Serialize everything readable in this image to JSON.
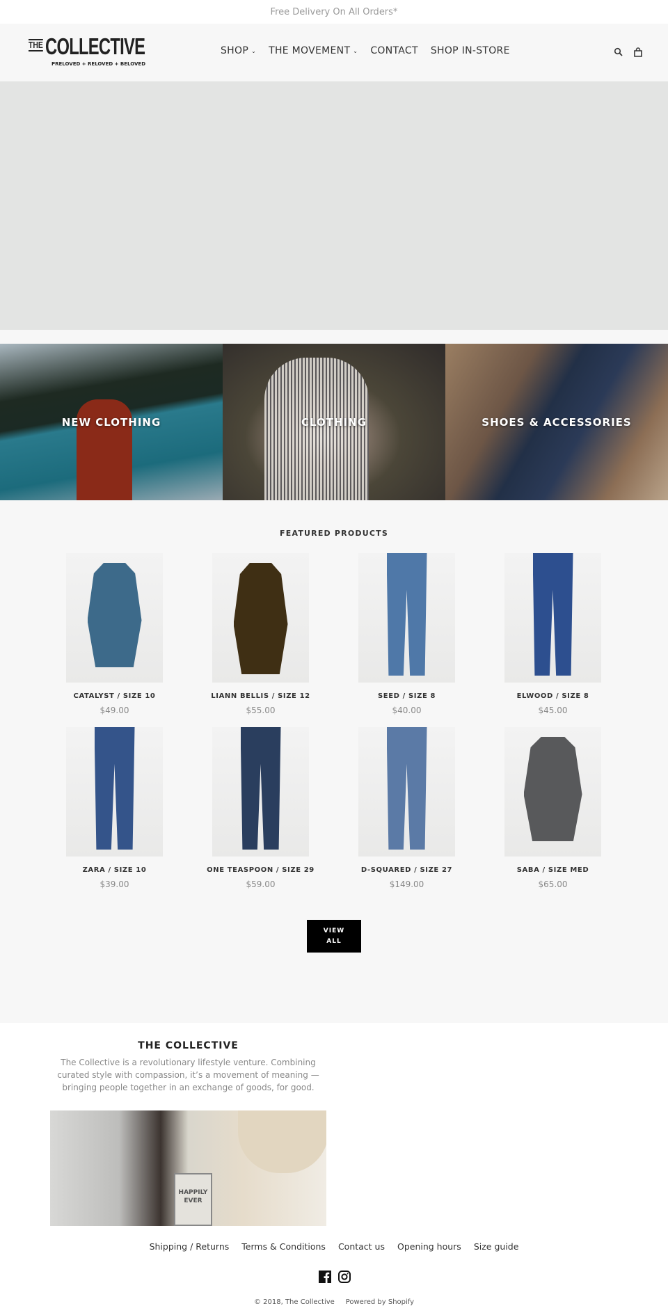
{
  "announcement": "Free Delivery On All Orders*",
  "logo": {
    "the": "THE",
    "name": "COLLECTIVE",
    "tagline": "PRELOVED + RELOVED + BELOVED"
  },
  "nav": [
    {
      "label": "SHOP",
      "dropdown": true
    },
    {
      "label": "THE MOVEMENT",
      "dropdown": true
    },
    {
      "label": "CONTACT",
      "dropdown": false
    },
    {
      "label": "SHOP IN-STORE",
      "dropdown": false
    }
  ],
  "header_icons": [
    "search-icon",
    "cart-icon"
  ],
  "collections": [
    {
      "label": "NEW CLOTHING"
    },
    {
      "label": "CLOTHING"
    },
    {
      "label": "SHOES & ACCESSORIES"
    }
  ],
  "featured": {
    "title": "FEATURED PRODUCTS",
    "view_all": "VIEW ALL",
    "products": [
      {
        "title": "CATALYST / SIZE 10",
        "price": "$49.00",
        "color": "#3d6a8a"
      },
      {
        "title": "LIANN BELLIS / SIZE 12",
        "price": "$55.00",
        "color": "#3f2f14"
      },
      {
        "title": "SEED / SIZE 8",
        "price": "$40.00",
        "color": "#4f78a8"
      },
      {
        "title": "ELWOOD / SIZE 8",
        "price": "$45.00",
        "color": "#2d4f8f"
      },
      {
        "title": "ZARA / SIZE 10",
        "price": "$39.00",
        "color": "#34548a"
      },
      {
        "title": "ONE TEASPOON / SIZE 29",
        "price": "$59.00",
        "color": "#2a3e5e"
      },
      {
        "title": "D-SQUARED / SIZE 27",
        "price": "$149.00",
        "color": "#5b7aa6"
      },
      {
        "title": "SABA / SIZE MED",
        "price": "$65.00",
        "color": "#58595b"
      }
    ]
  },
  "footer": {
    "title": "THE COLLECTIVE",
    "text": "The Collective is a revolutionary lifestyle venture. Combining curated style with compassion, it’s a movement of meaning — bringing people together in an exchange of goods, for good.",
    "image_sign_text": "HAPPILY EVER",
    "links": [
      "Shipping / Returns",
      "Terms & Conditions",
      "Contact us",
      "Opening hours",
      "Size guide"
    ],
    "social": [
      "facebook-icon",
      "instagram-icon"
    ],
    "copyright": "© 2018, The Collective",
    "powered": "Powered by Shopify"
  }
}
